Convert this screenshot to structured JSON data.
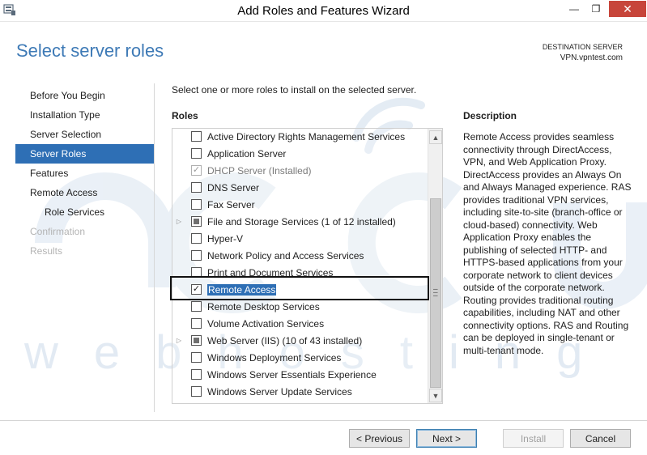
{
  "window": {
    "title": "Add Roles and Features Wizard",
    "minimize_glyph": "—",
    "restore_glyph": "❐",
    "close_glyph": "✕"
  },
  "header": {
    "page_title": "Select server roles",
    "destination_label": "DESTINATION SERVER",
    "destination_server": "VPN.vpntest.com"
  },
  "nav": {
    "items": [
      {
        "label": "Before You Begin",
        "state": "normal"
      },
      {
        "label": "Installation Type",
        "state": "normal"
      },
      {
        "label": "Server Selection",
        "state": "normal"
      },
      {
        "label": "Server Roles",
        "state": "active"
      },
      {
        "label": "Features",
        "state": "normal"
      },
      {
        "label": "Remote Access",
        "state": "normal"
      },
      {
        "label": "Role Services",
        "state": "sub"
      },
      {
        "label": "Confirmation",
        "state": "disabled"
      },
      {
        "label": "Results",
        "state": "disabled"
      }
    ]
  },
  "main": {
    "instruction": "Select one or more roles to install on the selected server.",
    "roles_heading": "Roles",
    "description_heading": "Description",
    "description": "Remote Access provides seamless connectivity through DirectAccess, VPN, and Web Application Proxy. DirectAccess provides an Always On and Always Managed experience. RAS provides traditional VPN services, including site-to-site (branch-office or cloud-based) connectivity. Web Application Proxy enables the publishing of selected HTTP- and HTTPS-based applications from your corporate network to client devices outside of the corporate network. Routing provides traditional routing capabilities, including NAT and other connectivity options. RAS and Routing can be deployed in single-tenant or multi-tenant mode.",
    "roles": [
      {
        "label": "Active Directory Rights Management Services",
        "state": "unchecked",
        "expander": false
      },
      {
        "label": "Application Server",
        "state": "unchecked",
        "expander": false
      },
      {
        "label": "DHCP Server (Installed)",
        "state": "disabled-checked",
        "expander": false
      },
      {
        "label": "DNS Server",
        "state": "unchecked",
        "expander": false
      },
      {
        "label": "Fax Server",
        "state": "unchecked",
        "expander": false
      },
      {
        "label": "File and Storage Services (1 of 12 installed)",
        "state": "partial",
        "expander": true
      },
      {
        "label": "Hyper-V",
        "state": "unchecked",
        "expander": false
      },
      {
        "label": "Network Policy and Access Services",
        "state": "unchecked",
        "expander": false
      },
      {
        "label": "Print and Document Services",
        "state": "unchecked",
        "expander": false
      },
      {
        "label": "Remote Access",
        "state": "checked",
        "expander": false,
        "selected": true
      },
      {
        "label": "Remote Desktop Services",
        "state": "unchecked",
        "expander": false
      },
      {
        "label": "Volume Activation Services",
        "state": "unchecked",
        "expander": false
      },
      {
        "label": "Web Server (IIS) (10 of 43 installed)",
        "state": "partial",
        "expander": true
      },
      {
        "label": "Windows Deployment Services",
        "state": "unchecked",
        "expander": false
      },
      {
        "label": "Windows Server Essentials Experience",
        "state": "unchecked",
        "expander": false
      },
      {
        "label": "Windows Server Update Services",
        "state": "unchecked",
        "expander": false
      }
    ]
  },
  "buttons": {
    "previous": "< Previous",
    "next": "Next >",
    "install": "Install",
    "cancel": "Cancel"
  },
  "watermark": {
    "text": "webhosting"
  },
  "colors": {
    "accent": "#2e6fb5",
    "title": "#3e7ab6",
    "close": "#c7453a"
  }
}
